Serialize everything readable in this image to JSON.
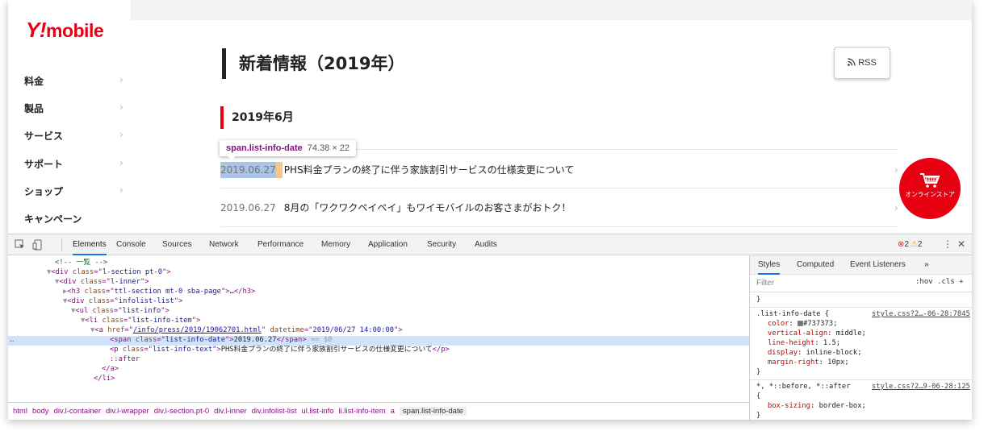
{
  "site": {
    "logo_y": "Y!",
    "logo_rest": "mobile",
    "nav": [
      {
        "label": "料金",
        "chevron": "›"
      },
      {
        "label": "製品",
        "chevron": "›"
      },
      {
        "label": "サービス",
        "chevron": "›"
      },
      {
        "label": "サポート",
        "chevron": "›"
      },
      {
        "label": "ショップ",
        "chevron": "›"
      },
      {
        "label": "キャンペーン",
        "chevron": ""
      }
    ],
    "page_title": "新着情報（2019年）",
    "rss_label": "RSS",
    "month_heading": "2019年6月",
    "news": [
      {
        "date": "2019.06.27",
        "text": "PHS料金プランの終了に伴う家族割引サービスの仕様変更について",
        "chevron": "›"
      },
      {
        "date": "2019.06.27",
        "text": "8月の「ワクワクペイペイ」もワイモバイルのお客さまがおトク！",
        "chevron": "›"
      }
    ],
    "cart_label": "オンラインストア",
    "accent_color": "#e60012"
  },
  "tooltip": {
    "selector": "span.list-info-date",
    "size": "74.38 × 22"
  },
  "devtools": {
    "tabs": [
      "Elements",
      "Console",
      "Sources",
      "Network",
      "Performance",
      "Memory",
      "Application",
      "Security",
      "Audits"
    ],
    "active_tab": "Elements",
    "error_count": "2",
    "warning_count": "2",
    "dom": {
      "l0": "<!-- 一覧 -->",
      "l1_tag": "div",
      "l1_attr": "class",
      "l1_val": "l-section pt-0",
      "l2_tag": "div",
      "l2_attr": "class",
      "l2_val": "l-inner",
      "l3_tag": "h3",
      "l3_attr": "class",
      "l3_val": "ttl-section mt-0 sba-page",
      "l3_tail": "…",
      "l4_tag": "div",
      "l4_attr": "class",
      "l4_val": "infolist-list",
      "l5_tag": "ul",
      "l5_attr": "class",
      "l5_val": "list-info",
      "l6_tag": "li",
      "l6_attr": "class",
      "l6_val": "list-info-item",
      "l7_tag": "a",
      "l7_attr": "href",
      "l7_val": "/info/press/2019/19062701.html",
      "l7_attr2": "datetime",
      "l7_val2": "2019/06/27 14:00:00",
      "l8_tag": "span",
      "l8_attr": "class",
      "l8_val": "list-info-date",
      "l8_text": "2019.06.27",
      "l8_eq": " == $0",
      "l9_tag": "p",
      "l9_attr": "class",
      "l9_val": "list-info-text",
      "l9_text": "PHS料金プランの終了に伴う家族割引サービスの仕様変更について",
      "l10": "::after",
      "l11": "</a>",
      "l12": "</li>"
    },
    "breadcrumbs": [
      "html",
      "body",
      "div.l-container",
      "div.l-wrapper",
      "div.l-section.pt-0",
      "div.l-inner",
      "div.infolist-list",
      "ul.list-info",
      "li.list-info-item",
      "a",
      "span.list-info-date"
    ],
    "styles": {
      "tabs": [
        "Styles",
        "Computed",
        "Event Listeners",
        "»"
      ],
      "filter_placeholder": "Filter",
      "filter_opts": ":hov  .cls  +",
      "brace_close": "}",
      "rule1_selector": ".list-info-date {",
      "rule1_source": "style.css?2…-06-28:7845",
      "rule1_props": [
        {
          "name": "color",
          "value": "#737373;"
        },
        {
          "name": "vertical-align",
          "value": "middle;"
        },
        {
          "name": "line-height",
          "value": "1.5;"
        },
        {
          "name": "display",
          "value": "inline-block;"
        },
        {
          "name": "margin-right",
          "value": "10px;"
        }
      ],
      "rule2_selector": "*, *::before, *::after",
      "rule2_source": "style.css?2…9-06-28:125",
      "rule2_open": "{",
      "rule2_props": [
        {
          "name": "box-sizing",
          "value": "border-box;"
        }
      ]
    }
  }
}
